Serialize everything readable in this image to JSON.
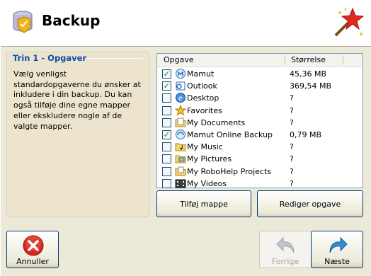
{
  "header": {
    "title": "Backup",
    "app_icon": "backup-shield-icon",
    "wizard_icon": "magic-wand-icon"
  },
  "step": {
    "title": "Trin 1 - Opgaver",
    "description": "Vælg venligst standardopgaverne du ønsker at inkludere i din backup. Du kan også tilføje dine egne mapper eller ekskludere nogle af de valgte mapper."
  },
  "task_list": {
    "columns": {
      "task": "Opgave",
      "size": "Størrelse"
    },
    "rows": [
      {
        "name": "Mamut",
        "size": "45,36 MB",
        "checked": true,
        "icon": "mamut-icon"
      },
      {
        "name": "Outlook",
        "size": "369,54 MB",
        "checked": true,
        "icon": "outlook-icon"
      },
      {
        "name": "Desktop",
        "size": "?",
        "checked": false,
        "icon": "desktop-icon"
      },
      {
        "name": "Favorites",
        "size": "?",
        "checked": false,
        "icon": "favorites-star-icon"
      },
      {
        "name": "My Documents",
        "size": "?",
        "checked": false,
        "icon": "documents-folder-icon"
      },
      {
        "name": "Mamut Online Backup",
        "size": "0,79 MB",
        "checked": true,
        "icon": "online-backup-icon"
      },
      {
        "name": "My Music",
        "size": "?",
        "checked": false,
        "icon": "music-folder-icon"
      },
      {
        "name": "My Pictures",
        "size": "?",
        "checked": false,
        "icon": "pictures-folder-icon"
      },
      {
        "name": "My RoboHelp Projects",
        "size": "?",
        "checked": false,
        "icon": "projects-folder-icon"
      },
      {
        "name": "My Videos",
        "size": "?",
        "checked": false,
        "icon": "videos-folder-icon"
      }
    ]
  },
  "buttons": {
    "add_folder": "Tilføj mappe",
    "edit_task": "Rediger opgave",
    "cancel": "Annuller",
    "previous": "Forrige",
    "next": "Næste"
  },
  "colors": {
    "accent_title": "#0b4fb0",
    "check": "#21a121",
    "cancel_red": "#d9261c",
    "next_arrow": "#2f8fd8"
  }
}
